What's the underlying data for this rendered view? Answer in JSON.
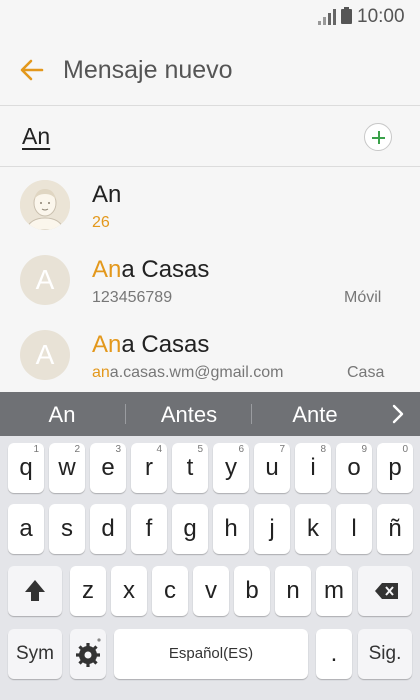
{
  "status": {
    "time": "10:00"
  },
  "appbar": {
    "title": "Mensaje nuevo"
  },
  "recipient": {
    "value": "An"
  },
  "suggestions": [
    {
      "name_hl": "",
      "name_rest": "An",
      "sub": "26",
      "type": ""
    },
    {
      "name_hl": "An",
      "name_rest": "a Casas",
      "sub_hl": "",
      "sub": "123456789",
      "type": "Móvil"
    },
    {
      "name_hl": "An",
      "name_rest": "a Casas",
      "sub_hl": "an",
      "sub": "a.casas.wm@gmail.com",
      "type": "Casa"
    }
  ],
  "avatar_letter": "A",
  "predictions": [
    "An",
    "Antes",
    "Ante"
  ],
  "keyboard": {
    "row1": [
      {
        "ch": "q",
        "num": "1"
      },
      {
        "ch": "w",
        "num": "2"
      },
      {
        "ch": "e",
        "num": "3"
      },
      {
        "ch": "r",
        "num": "4"
      },
      {
        "ch": "t",
        "num": "5"
      },
      {
        "ch": "y",
        "num": "6"
      },
      {
        "ch": "u",
        "num": "7"
      },
      {
        "ch": "i",
        "num": "8"
      },
      {
        "ch": "o",
        "num": "9"
      },
      {
        "ch": "p",
        "num": "0"
      }
    ],
    "row2": [
      "a",
      "s",
      "d",
      "f",
      "g",
      "h",
      "j",
      "k",
      "l",
      "ñ"
    ],
    "row3": [
      "z",
      "x",
      "c",
      "v",
      "b",
      "n",
      "m"
    ],
    "sym": "Sym",
    "space": "Español(ES)",
    "period": ".",
    "next": "Sig."
  },
  "colors": {
    "accent": "#e3981c",
    "add_green": "#3aa14a"
  }
}
